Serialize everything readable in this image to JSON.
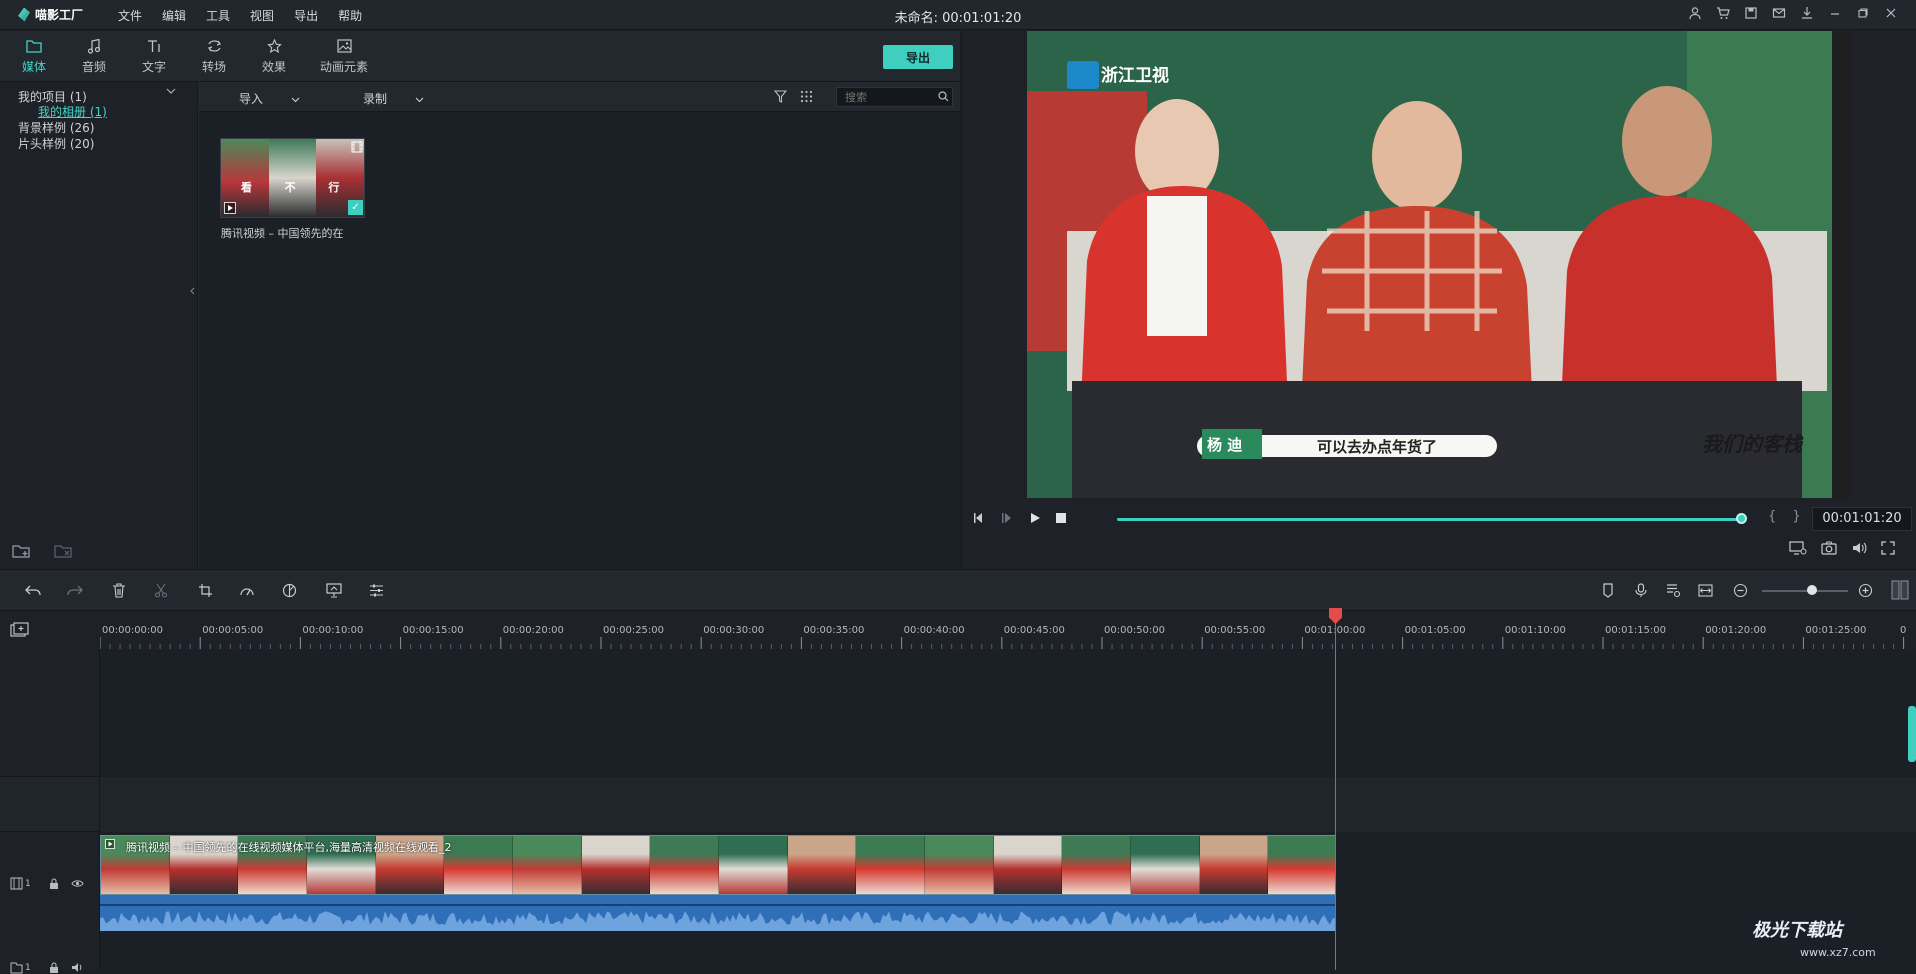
{
  "app": {
    "logo_text": "喵影工厂",
    "menu": [
      "文件",
      "编辑",
      "工具",
      "视图",
      "导出",
      "帮助"
    ],
    "project_title": "未命名: 00:01:01:20"
  },
  "media_panel": {
    "tabs": [
      {
        "label": "媒体",
        "icon": "folder-icon",
        "active": true
      },
      {
        "label": "音频",
        "icon": "music-note-icon",
        "active": false
      },
      {
        "label": "文字",
        "icon": "text-icon",
        "active": false
      },
      {
        "label": "转场",
        "icon": "transition-icon",
        "active": false
      },
      {
        "label": "效果",
        "icon": "effects-icon",
        "active": false
      },
      {
        "label": "动画元素",
        "icon": "image-icon",
        "active": false
      }
    ],
    "export_label": "导出",
    "tree": [
      {
        "label": "我的项目 (1)"
      },
      {
        "label": "我的相册 (1)"
      },
      {
        "label": "背景样例 (26)"
      },
      {
        "label": "片头样例 (20)"
      }
    ],
    "toolbar": {
      "import_label": "导入",
      "record_label": "录制",
      "search_placeholder": "搜索"
    },
    "thumbnail": {
      "label": "腾讯视频 – 中国领先的在",
      "frame_chars": [
        "看",
        "不",
        "行"
      ]
    }
  },
  "preview": {
    "channel_logo": "浙江卫视",
    "name_tag": "杨 迪",
    "subtitle": "可以去办点年货了",
    "show_logo": "我们的客栈",
    "time": "00:01:01:20",
    "progress": 0.99,
    "bracket_label": "{ }"
  },
  "timeline": {
    "ruler": [
      "00:00:00:00",
      "00:00:05:00",
      "00:00:10:00",
      "00:00:15:00",
      "00:00:20:00",
      "00:00:25:00",
      "00:00:30:00",
      "00:00:35:00",
      "00:00:40:00",
      "00:00:45:00",
      "00:00:50:00",
      "00:00:55:00",
      "00:01:00:00",
      "00:01:05:00",
      "00:01:10:00",
      "00:01:15:00",
      "00:01:20:00",
      "00:01:25:00",
      "0"
    ],
    "clip_title": "腾讯视频 – 中国领先的在线视频媒体平台,海量高清视频在线观看_2",
    "track_video_label": "1",
    "track_audio_label": "1"
  },
  "watermark": {
    "text": "极光下载站",
    "url": "www.xz7.com"
  },
  "colors": {
    "accent": "#3fcfc1",
    "playhead": "#e54b4b",
    "audio_wave": "#2e6fb8"
  }
}
